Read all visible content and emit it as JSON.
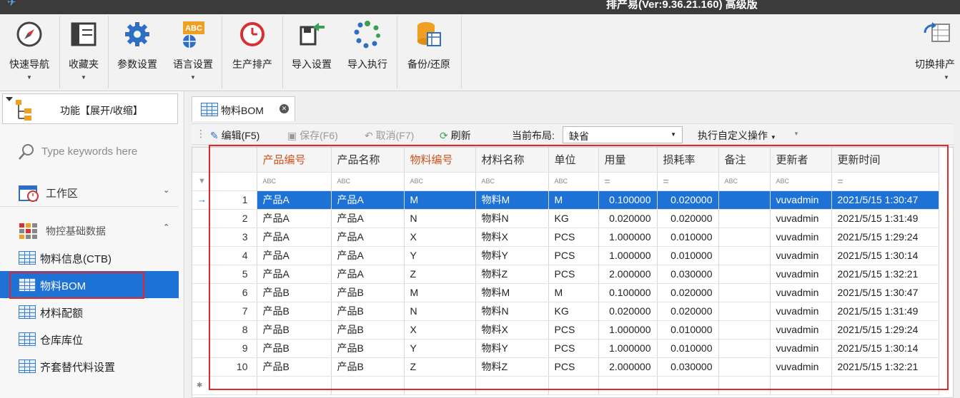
{
  "window": {
    "title": "排产易(Ver:9.36.21.160) 高级版"
  },
  "ribbon": {
    "buttons": [
      {
        "label": "快速导航",
        "icon": "compass-icon"
      },
      {
        "label": "收藏夹",
        "icon": "favorites-panel-icon"
      },
      {
        "label": "参数设置",
        "icon": "gear-icon"
      },
      {
        "label": "语言设置",
        "icon": "language-abc-icon"
      },
      {
        "label": "生产排产",
        "icon": "clock-icon"
      },
      {
        "label": "导入设置",
        "icon": "import-settings-icon"
      },
      {
        "label": "导入执行",
        "icon": "import-execute-icon"
      },
      {
        "label": "备份/还原",
        "icon": "database-backup-icon"
      },
      {
        "label": "切换排产",
        "icon": "switch-schedule-icon"
      }
    ]
  },
  "sidebar": {
    "function_toggle": "功能【展开/收缩】",
    "search_placeholder": "Type keywords here",
    "groups": [
      {
        "label": "工作区"
      },
      {
        "label": "物控基础数据"
      }
    ],
    "items": [
      {
        "label": "物料信息(CTB)"
      },
      {
        "label": "物料BOM"
      },
      {
        "label": "材料配额"
      },
      {
        "label": "仓库库位"
      },
      {
        "label": "齐套替代料设置"
      }
    ]
  },
  "tab": {
    "label": "物料BOM"
  },
  "toolbar": {
    "edit": "编辑(F5)",
    "save": "保存(F6)",
    "cancel": "取消(F7)",
    "refresh": "刷新",
    "layout_label": "当前布局:",
    "layout_value": "缺省",
    "custom_ops": "执行自定义操作"
  },
  "grid": {
    "columns": [
      "产品编号",
      "产品名称",
      "物料编号",
      "材料名称",
      "单位",
      "用量",
      "损耗率",
      "备注",
      "更新者",
      "更新时间"
    ],
    "filter_text": "ABC",
    "filter_eq": "=",
    "rows": [
      [
        "1",
        "产品A",
        "产品A",
        "M",
        "物料M",
        "M",
        "0.100000",
        "0.020000",
        "",
        "vuvadmin",
        "2021/5/15 1:30:47"
      ],
      [
        "2",
        "产品A",
        "产品A",
        "N",
        "物料N",
        "KG",
        "0.020000",
        "0.020000",
        "",
        "vuvadmin",
        "2021/5/15 1:31:49"
      ],
      [
        "3",
        "产品A",
        "产品A",
        "X",
        "物料X",
        "PCS",
        "1.000000",
        "0.010000",
        "",
        "vuvadmin",
        "2021/5/15 1:29:24"
      ],
      [
        "4",
        "产品A",
        "产品A",
        "Y",
        "物料Y",
        "PCS",
        "1.000000",
        "0.010000",
        "",
        "vuvadmin",
        "2021/5/15 1:30:14"
      ],
      [
        "5",
        "产品A",
        "产品A",
        "Z",
        "物料Z",
        "PCS",
        "2.000000",
        "0.030000",
        "",
        "vuvadmin",
        "2021/5/15 1:32:21"
      ],
      [
        "6",
        "产品B",
        "产品B",
        "M",
        "物料M",
        "M",
        "0.100000",
        "0.020000",
        "",
        "vuvadmin",
        "2021/5/15 1:30:47"
      ],
      [
        "7",
        "产品B",
        "产品B",
        "N",
        "物料N",
        "KG",
        "0.020000",
        "0.020000",
        "",
        "vuvadmin",
        "2021/5/15 1:31:49"
      ],
      [
        "8",
        "产品B",
        "产品B",
        "X",
        "物料X",
        "PCS",
        "1.000000",
        "0.010000",
        "",
        "vuvadmin",
        "2021/5/15 1:29:24"
      ],
      [
        "9",
        "产品B",
        "产品B",
        "Y",
        "物料Y",
        "PCS",
        "1.000000",
        "0.010000",
        "",
        "vuvadmin",
        "2021/5/15 1:30:14"
      ],
      [
        "10",
        "产品B",
        "产品B",
        "Z",
        "物料Z",
        "PCS",
        "2.000000",
        "0.030000",
        "",
        "vuvadmin",
        "2021/5/15 1:32:21"
      ]
    ]
  },
  "colors": {
    "accent": "#1e72d6",
    "highlight_border": "#e02828",
    "key_column": "#d0531b"
  }
}
